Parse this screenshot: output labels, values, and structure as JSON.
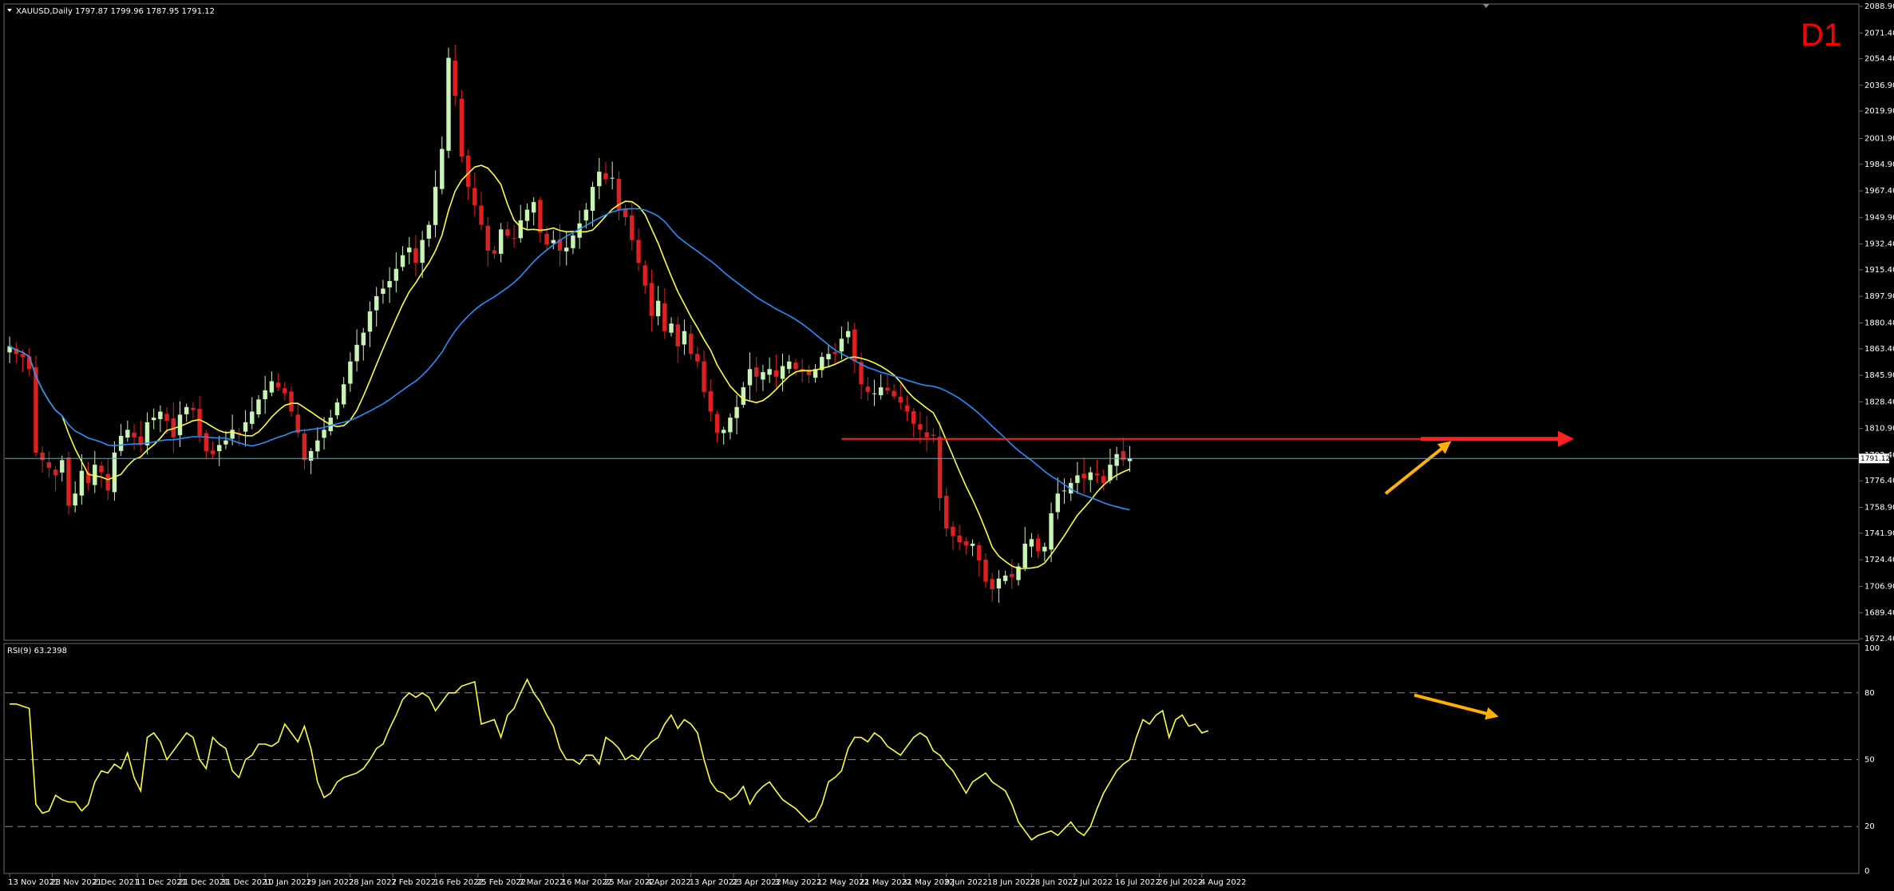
{
  "chart_data": [
    {
      "type": "candlestick",
      "symbol_header": "XAUUSD,Daily  1797.87 1799.96 1787.95 1791.12",
      "timeframe_label": "D1",
      "ylim": [
        1672.4,
        2088.9
      ],
      "price_ticks": [
        "2088.90",
        "2071.40",
        "2054.40",
        "2036.90",
        "2019.90",
        "2001.90",
        "1984.90",
        "1967.40",
        "1949.90",
        "1932.40",
        "1915.40",
        "1897.90",
        "1880.40",
        "1863.40",
        "1845.90",
        "1828.40",
        "1810.90",
        "1793.40",
        "1776.40",
        "1758.90",
        "1741.90",
        "1724.40",
        "1706.90",
        "1689.40",
        "1672.40"
      ],
      "current_price": "1791.12",
      "date_ticks": [
        "13 Nov 2021",
        "23 Nov 2021",
        "2 Dec 2021",
        "11 Dec 2021",
        "21 Dec 2021",
        "31 Dec 2021",
        "10 Jan 2022",
        "19 Jan 2022",
        "28 Jan 2022",
        "7 Feb 2022",
        "16 Feb 2022",
        "25 Feb 2022",
        "7 Mar 2022",
        "16 Mar 2022",
        "25 Mar 2022",
        "4 Apr 2022",
        "13 Apr 2022",
        "23 Apr 2022",
        "3 May 2022",
        "12 May 2022",
        "21 May 2022",
        "31 May 2022",
        "9 Jun 2022",
        "18 Jun 2022",
        "28 Jun 2022",
        "7 Jul 2022",
        "16 Jul 2022",
        "26 Jul 2022",
        "4 Aug 2022"
      ],
      "close_path": [
        1865,
        1860,
        1858,
        1850,
        1795,
        1790,
        1785,
        1780,
        1790,
        1760,
        1768,
        1783,
        1775,
        1787,
        1782,
        1770,
        1795,
        1806,
        1810,
        1805,
        1800,
        1815,
        1818,
        1822,
        1816,
        1805,
        1820,
        1825,
        1823,
        1806,
        1796,
        1794,
        1800,
        1803,
        1810,
        1808,
        1815,
        1822,
        1830,
        1836,
        1842,
        1838,
        1834,
        1822,
        1808,
        1790,
        1796,
        1803,
        1810,
        1818,
        1828,
        1840,
        1855,
        1866,
        1874,
        1888,
        1898,
        1903,
        1908,
        1916,
        1925,
        1930,
        1920,
        1935,
        1945,
        1970,
        1995,
        2055,
        2030,
        1990,
        1970,
        1958,
        1945,
        1928,
        1926,
        1942,
        1938,
        1936,
        1948,
        1955,
        1960,
        1940,
        1932,
        1935,
        1928,
        1930,
        1938,
        1946,
        1955,
        1970,
        1980,
        1975,
        1976,
        1955,
        1950,
        1935,
        1920,
        1905,
        1885,
        1895,
        1875,
        1880,
        1865,
        1875,
        1860,
        1855,
        1835,
        1822,
        1808,
        1810,
        1818,
        1825,
        1838,
        1850,
        1845,
        1848,
        1850,
        1845,
        1852,
        1855,
        1850,
        1848,
        1846,
        1850,
        1858,
        1860,
        1860,
        1870,
        1875,
        1855,
        1840,
        1835,
        1834,
        1838,
        1836,
        1832,
        1828,
        1822,
        1814,
        1810,
        1805,
        1806,
        1765,
        1745,
        1740,
        1736,
        1734,
        1735,
        1724,
        1710,
        1705,
        1712,
        1714,
        1713,
        1720,
        1735,
        1738,
        1730,
        1733,
        1755,
        1768,
        1770,
        1775,
        1780,
        1778,
        1782,
        1780,
        1775,
        1787,
        1794,
        1790,
        1791
      ]
    },
    {
      "type": "line",
      "title": "RSI(9) 63.2398",
      "ylim": [
        0,
        100
      ],
      "ticks": [
        "100",
        "80",
        "50",
        "20",
        "0"
      ],
      "levels": [
        80,
        50,
        20
      ],
      "values": [
        75,
        75,
        74,
        73,
        30,
        26,
        27,
        34,
        32,
        31,
        31,
        27,
        30,
        40,
        45,
        44,
        48,
        46,
        53,
        42,
        36,
        60,
        62,
        58,
        50,
        54,
        58,
        62,
        60,
        50,
        46,
        60,
        57,
        55,
        45,
        42,
        50,
        52,
        57,
        57,
        56,
        58,
        66,
        62,
        58,
        65,
        55,
        40,
        33,
        35,
        40,
        42,
        43,
        44,
        46,
        50,
        55,
        57,
        64,
        70,
        77,
        80,
        78,
        80,
        78,
        72,
        76,
        80,
        80,
        83,
        84,
        85,
        66,
        67,
        68,
        60,
        70,
        73,
        80,
        86,
        80,
        76,
        70,
        65,
        55,
        50,
        50,
        48,
        52,
        52,
        48,
        60,
        58,
        55,
        50,
        52,
        50,
        55,
        58,
        60,
        66,
        70,
        64,
        68,
        66,
        62,
        50,
        40,
        36,
        35,
        32,
        34,
        38,
        30,
        35,
        38,
        40,
        36,
        32,
        30,
        28,
        25,
        22,
        24,
        30,
        40,
        42,
        45,
        55,
        60,
        60,
        58,
        62,
        60,
        56,
        54,
        52,
        56,
        60,
        62,
        60,
        54,
        52,
        48,
        45,
        40,
        35,
        40,
        42,
        44,
        40,
        38,
        36,
        30,
        22,
        18,
        14,
        16,
        17,
        18,
        16,
        19,
        22,
        18,
        16,
        20,
        28,
        35,
        40,
        45,
        48,
        50,
        60,
        68,
        66,
        70,
        72,
        60,
        68,
        70,
        65,
        66,
        62,
        63
      ]
    }
  ]
}
